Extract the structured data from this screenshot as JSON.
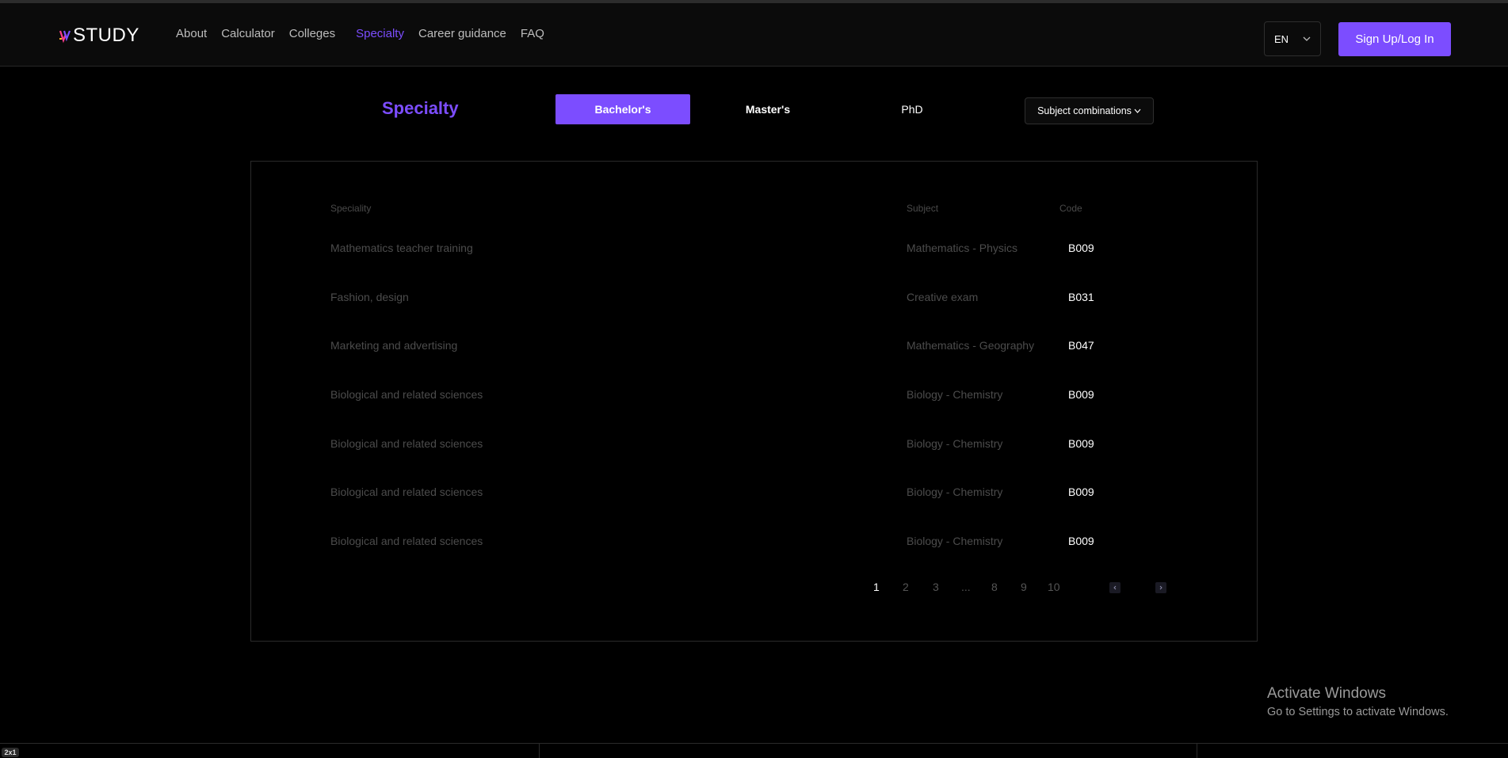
{
  "brand": {
    "name": "STUDY"
  },
  "nav": {
    "links": [
      {
        "label": "About",
        "active": false
      },
      {
        "label": "Calculator",
        "active": false
      },
      {
        "label": "Colleges",
        "active": false
      },
      {
        "label": "Specialty",
        "active": true
      },
      {
        "label": "Career guidance",
        "active": false
      },
      {
        "label": "FAQ",
        "active": false
      }
    ],
    "language": "EN",
    "signup_label": "Sign Up/Log In"
  },
  "page": {
    "title": "Specialty",
    "tabs": [
      {
        "label": "Bachelor's",
        "active": true
      },
      {
        "label": "Master's",
        "active": false
      },
      {
        "label": "PhD",
        "active": false
      }
    ],
    "filter_label": "Subject combinations"
  },
  "table": {
    "headers": {
      "speciality": "Speciality",
      "subject": "Subject",
      "code": "Code"
    },
    "rows": [
      {
        "speciality": "Mathematics teacher training",
        "subject": "Mathematics - Physics",
        "code": "B009"
      },
      {
        "speciality": "Fashion, design",
        "subject": "Creative exam",
        "code": "B031"
      },
      {
        "speciality": "Marketing and advertising",
        "subject": "Mathematics - Geography",
        "code": "B047"
      },
      {
        "speciality": "Biological and related sciences",
        "subject": "Biology - Chemistry",
        "code": "B009"
      },
      {
        "speciality": "Biological and related sciences",
        "subject": "Biology - Chemistry",
        "code": "B009"
      },
      {
        "speciality": "Biological and related sciences",
        "subject": "Biology - Chemistry",
        "code": "B009"
      },
      {
        "speciality": "Biological and related sciences",
        "subject": "Biology - Chemistry",
        "code": "B009"
      }
    ]
  },
  "pagination": {
    "pages": [
      "1",
      "2",
      "3",
      "...",
      "8",
      "9",
      "10"
    ],
    "current": "1"
  },
  "os_overlay": {
    "title": "Activate Windows",
    "subtitle": "Go to Settings to activate Windows.",
    "badge": "2x1"
  },
  "colors": {
    "accent": "#7c4dff",
    "background": "#000000"
  },
  "icons": {
    "dropdown": "chevron-down-icon"
  }
}
